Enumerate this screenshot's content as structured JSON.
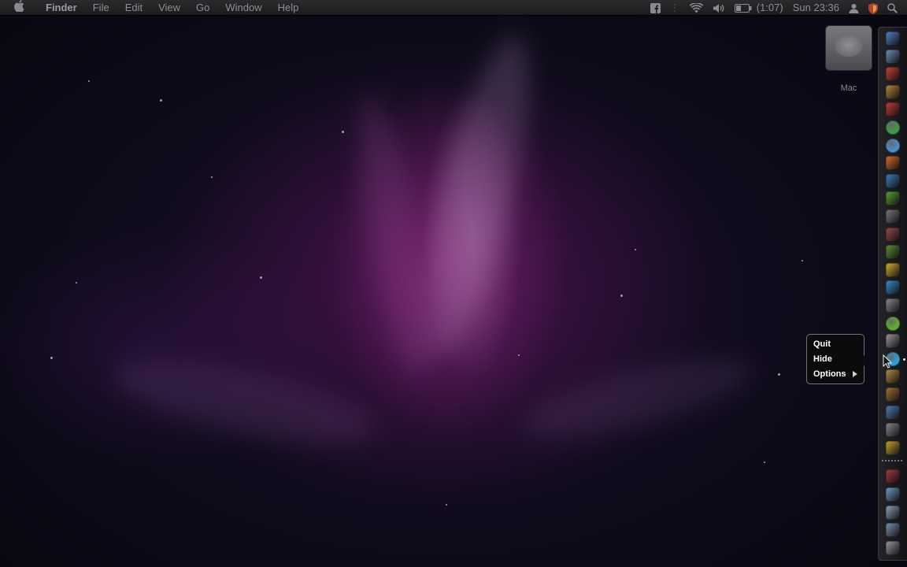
{
  "menubar": {
    "apple_icon": "apple-logo-icon",
    "app_name": "Finder",
    "menus": [
      "File",
      "Edit",
      "View",
      "Go",
      "Window",
      "Help"
    ],
    "battery_text": "(1:07)",
    "clock": "Sun 23:36",
    "status_icons": [
      "facebook-icon",
      "wifi-icon",
      "volume-icon",
      "battery-icon",
      "user-icon",
      "shield-icon",
      "spotlight-icon"
    ]
  },
  "desktop": {
    "drive_label": "Mac"
  },
  "dock": {
    "icons": [
      {
        "name": "finder-icon",
        "color": "#4f86c7"
      },
      {
        "name": "mail-icon",
        "color": "#6f8fb8"
      },
      {
        "name": "calendar-icon",
        "color": "#c8413a"
      },
      {
        "name": "photos-icon",
        "color": "#b78a3b"
      },
      {
        "name": "flashcard-icon",
        "color": "#c43b34"
      },
      {
        "name": "chrome-icon",
        "color": "#3c9a47"
      },
      {
        "name": "safari-icon",
        "color": "#4a8fcf"
      },
      {
        "name": "firefox-icon",
        "color": "#d9702a"
      },
      {
        "name": "wordpress-icon",
        "color": "#3f7fb8"
      },
      {
        "name": "bittorrent-icon",
        "color": "#5aa136"
      },
      {
        "name": "camera-icon",
        "color": "#7a7a7a"
      },
      {
        "name": "toolbox-icon",
        "color": "#9a4a4a"
      },
      {
        "name": "brush-icon",
        "color": "#5f8f3a"
      },
      {
        "name": "smiley-icon",
        "color": "#d8b12a"
      },
      {
        "name": "messenger-icon",
        "color": "#3a8fc9"
      },
      {
        "name": "star-icon",
        "color": "#8a8a8a"
      },
      {
        "name": "spotify-icon",
        "color": "#5fae2f"
      },
      {
        "name": "document-icon",
        "color": "#9a9a9a"
      },
      {
        "name": "skype-icon",
        "color": "#2aa2dc"
      },
      {
        "name": "folder-photo-icon",
        "color": "#b48c46"
      },
      {
        "name": "guitar-icon",
        "color": "#a57232"
      },
      {
        "name": "globe-icon",
        "color": "#4f7fae"
      },
      {
        "name": "system-preferences-icon",
        "color": "#8a8a8e"
      },
      {
        "name": "mailbox-icon",
        "color": "#c9a32a"
      },
      {
        "name": "record-icon",
        "color": "#a53b3b"
      },
      {
        "name": "folder-icon",
        "color": "#6f9ec9"
      },
      {
        "name": "downloads-icon",
        "color": "#8fa3b8"
      },
      {
        "name": "screen-icon",
        "color": "#7a94b3"
      },
      {
        "name": "trash-icon",
        "color": "#9a9aa0"
      }
    ]
  },
  "context_menu": {
    "items": [
      "Quit",
      "Hide",
      "Options"
    ]
  }
}
